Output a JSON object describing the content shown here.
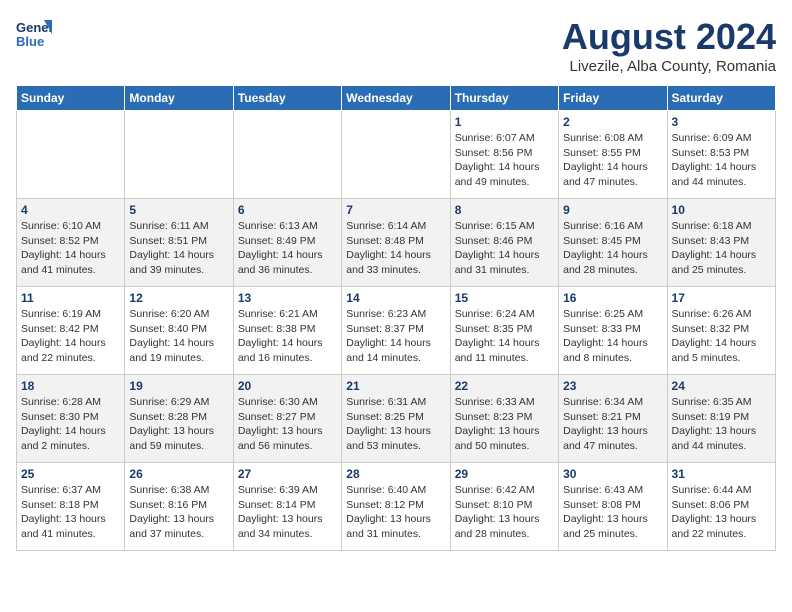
{
  "header": {
    "logo_line1": "General",
    "logo_line2": "Blue",
    "title": "August 2024",
    "subtitle": "Livezile, Alba County, Romania"
  },
  "weekdays": [
    "Sunday",
    "Monday",
    "Tuesday",
    "Wednesday",
    "Thursday",
    "Friday",
    "Saturday"
  ],
  "weeks": [
    [
      {
        "day": "",
        "info": ""
      },
      {
        "day": "",
        "info": ""
      },
      {
        "day": "",
        "info": ""
      },
      {
        "day": "",
        "info": ""
      },
      {
        "day": "1",
        "info": "Sunrise: 6:07 AM\nSunset: 8:56 PM\nDaylight: 14 hours\nand 49 minutes."
      },
      {
        "day": "2",
        "info": "Sunrise: 6:08 AM\nSunset: 8:55 PM\nDaylight: 14 hours\nand 47 minutes."
      },
      {
        "day": "3",
        "info": "Sunrise: 6:09 AM\nSunset: 8:53 PM\nDaylight: 14 hours\nand 44 minutes."
      }
    ],
    [
      {
        "day": "4",
        "info": "Sunrise: 6:10 AM\nSunset: 8:52 PM\nDaylight: 14 hours\nand 41 minutes."
      },
      {
        "day": "5",
        "info": "Sunrise: 6:11 AM\nSunset: 8:51 PM\nDaylight: 14 hours\nand 39 minutes."
      },
      {
        "day": "6",
        "info": "Sunrise: 6:13 AM\nSunset: 8:49 PM\nDaylight: 14 hours\nand 36 minutes."
      },
      {
        "day": "7",
        "info": "Sunrise: 6:14 AM\nSunset: 8:48 PM\nDaylight: 14 hours\nand 33 minutes."
      },
      {
        "day": "8",
        "info": "Sunrise: 6:15 AM\nSunset: 8:46 PM\nDaylight: 14 hours\nand 31 minutes."
      },
      {
        "day": "9",
        "info": "Sunrise: 6:16 AM\nSunset: 8:45 PM\nDaylight: 14 hours\nand 28 minutes."
      },
      {
        "day": "10",
        "info": "Sunrise: 6:18 AM\nSunset: 8:43 PM\nDaylight: 14 hours\nand 25 minutes."
      }
    ],
    [
      {
        "day": "11",
        "info": "Sunrise: 6:19 AM\nSunset: 8:42 PM\nDaylight: 14 hours\nand 22 minutes."
      },
      {
        "day": "12",
        "info": "Sunrise: 6:20 AM\nSunset: 8:40 PM\nDaylight: 14 hours\nand 19 minutes."
      },
      {
        "day": "13",
        "info": "Sunrise: 6:21 AM\nSunset: 8:38 PM\nDaylight: 14 hours\nand 16 minutes."
      },
      {
        "day": "14",
        "info": "Sunrise: 6:23 AM\nSunset: 8:37 PM\nDaylight: 14 hours\nand 14 minutes."
      },
      {
        "day": "15",
        "info": "Sunrise: 6:24 AM\nSunset: 8:35 PM\nDaylight: 14 hours\nand 11 minutes."
      },
      {
        "day": "16",
        "info": "Sunrise: 6:25 AM\nSunset: 8:33 PM\nDaylight: 14 hours\nand 8 minutes."
      },
      {
        "day": "17",
        "info": "Sunrise: 6:26 AM\nSunset: 8:32 PM\nDaylight: 14 hours\nand 5 minutes."
      }
    ],
    [
      {
        "day": "18",
        "info": "Sunrise: 6:28 AM\nSunset: 8:30 PM\nDaylight: 14 hours\nand 2 minutes."
      },
      {
        "day": "19",
        "info": "Sunrise: 6:29 AM\nSunset: 8:28 PM\nDaylight: 13 hours\nand 59 minutes."
      },
      {
        "day": "20",
        "info": "Sunrise: 6:30 AM\nSunset: 8:27 PM\nDaylight: 13 hours\nand 56 minutes."
      },
      {
        "day": "21",
        "info": "Sunrise: 6:31 AM\nSunset: 8:25 PM\nDaylight: 13 hours\nand 53 minutes."
      },
      {
        "day": "22",
        "info": "Sunrise: 6:33 AM\nSunset: 8:23 PM\nDaylight: 13 hours\nand 50 minutes."
      },
      {
        "day": "23",
        "info": "Sunrise: 6:34 AM\nSunset: 8:21 PM\nDaylight: 13 hours\nand 47 minutes."
      },
      {
        "day": "24",
        "info": "Sunrise: 6:35 AM\nSunset: 8:19 PM\nDaylight: 13 hours\nand 44 minutes."
      }
    ],
    [
      {
        "day": "25",
        "info": "Sunrise: 6:37 AM\nSunset: 8:18 PM\nDaylight: 13 hours\nand 41 minutes."
      },
      {
        "day": "26",
        "info": "Sunrise: 6:38 AM\nSunset: 8:16 PM\nDaylight: 13 hours\nand 37 minutes."
      },
      {
        "day": "27",
        "info": "Sunrise: 6:39 AM\nSunset: 8:14 PM\nDaylight: 13 hours\nand 34 minutes."
      },
      {
        "day": "28",
        "info": "Sunrise: 6:40 AM\nSunset: 8:12 PM\nDaylight: 13 hours\nand 31 minutes."
      },
      {
        "day": "29",
        "info": "Sunrise: 6:42 AM\nSunset: 8:10 PM\nDaylight: 13 hours\nand 28 minutes."
      },
      {
        "day": "30",
        "info": "Sunrise: 6:43 AM\nSunset: 8:08 PM\nDaylight: 13 hours\nand 25 minutes."
      },
      {
        "day": "31",
        "info": "Sunrise: 6:44 AM\nSunset: 8:06 PM\nDaylight: 13 hours\nand 22 minutes."
      }
    ]
  ]
}
